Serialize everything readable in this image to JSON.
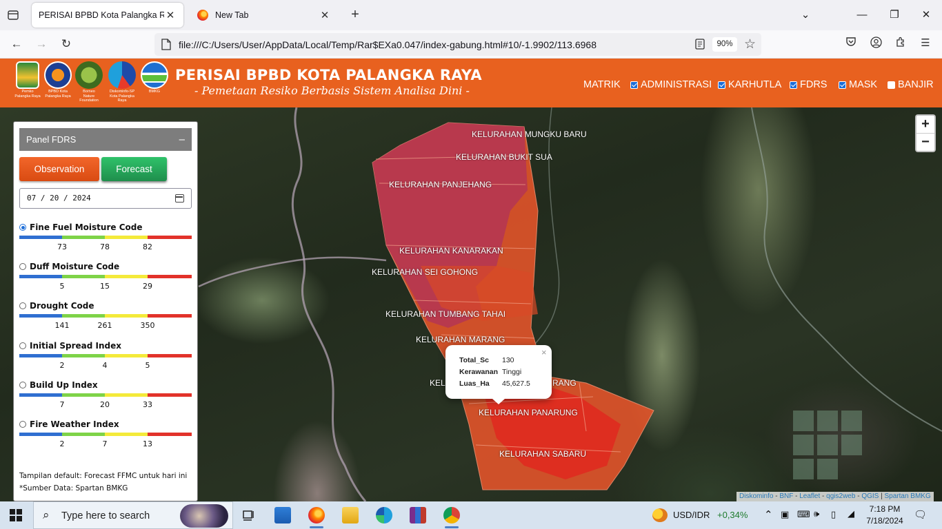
{
  "browser": {
    "tabs": [
      {
        "title": "PERISAI BPBD Kota Palangka Raya",
        "active": true
      },
      {
        "title": "New Tab",
        "active": false
      }
    ],
    "url": "file:///C:/Users/User/AppData/Local/Temp/Rar$EXa0.047/index-gabung.html#10/-1.9902/113.6968",
    "zoom": "90%"
  },
  "header": {
    "title": "PERISAI BPBD KOTA PALANGKA RAYA",
    "subtitle": "- Pemetaan Resiko Berbasis Sistem Analisa Dini -",
    "logos": [
      {
        "caption": "Pemko\nPalangka Raya",
        "icon": "pemko-emblem-icon"
      },
      {
        "caption": "BPBD Kota\nPalangka Raya",
        "icon": "bpbd-emblem-icon"
      },
      {
        "caption": "Borneo\nNature\nFoundation",
        "icon": "bnf-emblem-icon"
      },
      {
        "caption": "Diskominfo-SP\nKota Palangka Raya",
        "icon": "diskominfo-emblem-icon"
      },
      {
        "caption": "BMKG",
        "icon": "bmkg-emblem-icon"
      }
    ],
    "menu": [
      {
        "label": "MATRIK",
        "checkbox": null
      },
      {
        "label": "ADMINISTRASI",
        "checkbox": true
      },
      {
        "label": "KARHUTLA",
        "checkbox": true
      },
      {
        "label": "FDRS",
        "checkbox": true
      },
      {
        "label": "MASK",
        "checkbox": true
      },
      {
        "label": "BANJIR",
        "checkbox": false
      }
    ]
  },
  "panel": {
    "title": "Panel FDRS",
    "collapse_symbol": "–",
    "observation_label": "Observation",
    "forecast_label": "Forecast",
    "date_value": "07 / 20 / 2024",
    "indices": [
      {
        "label": "Fine Fuel Moisture Code",
        "selected": true,
        "ticks": [
          "73",
          "78",
          "82"
        ]
      },
      {
        "label": "Duff Moisture Code",
        "selected": false,
        "ticks": [
          "5",
          "15",
          "29"
        ]
      },
      {
        "label": "Drought Code",
        "selected": false,
        "ticks": [
          "141",
          "261",
          "350"
        ]
      },
      {
        "label": "Initial Spread Index",
        "selected": false,
        "ticks": [
          "2",
          "4",
          "5"
        ]
      },
      {
        "label": "Build Up Index",
        "selected": false,
        "ticks": [
          "7",
          "20",
          "33"
        ]
      },
      {
        "label": "Fire Weather Index",
        "selected": false,
        "ticks": [
          "2",
          "7",
          "13"
        ]
      }
    ],
    "scale_colors": [
      "#2f6fd1",
      "#7ed348",
      "#f4ea3a",
      "#e2322a"
    ],
    "note_default": "Tampilan default: Forecast FFMC untuk hari ini",
    "note_source": "*Sumber Data: Spartan BMKG"
  },
  "map": {
    "labels": [
      "KELURAHAN MUNGKU BARU",
      "KELURAHAN BUKIT SUA",
      "KELURAHAN PANJEHANG",
      "KELURAHAN KANARAKAN",
      "KELURAHAN SEI GOHONG",
      "KELURAHAN TUMBANG TAHAI",
      "KELURAHAN MARANG",
      "KEL",
      "RANG",
      "KELURAHAN PANARUNG",
      "KELURAHAN SABARU"
    ],
    "popup": {
      "close": "×",
      "rows": [
        {
          "key": "Total_Sc",
          "value": "130"
        },
        {
          "key": "Kerawanan",
          "value": "Tinggi"
        },
        {
          "key": "Luas_Ha",
          "value": "45,627.5"
        }
      ]
    },
    "zoom_in": "+",
    "zoom_out": "−",
    "attribution": [
      "Diskominfo",
      "BNF",
      "Leaflet",
      "qgis2web",
      "QGIS",
      "Spartan BMKG"
    ],
    "colors": {
      "high_risk": "#e2542a",
      "very_high_risk": "#b0325a",
      "extreme": "#e0281e"
    }
  },
  "taskbar": {
    "search_placeholder": "Type here to search",
    "currency_label": "USD/IDR",
    "currency_change": "+0,34%",
    "time": "7:18 PM",
    "date": "7/18/2024"
  }
}
